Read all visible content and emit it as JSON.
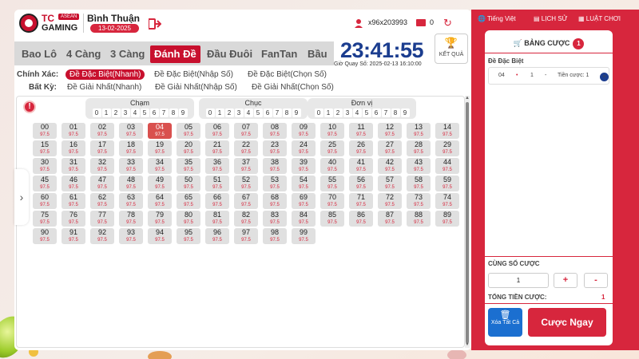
{
  "header": {
    "logo_tc": "TC",
    "logo_asean": "ASEAN",
    "logo_gaming": "GAMING",
    "province": "Bình Thuận",
    "date": "13-02-2025",
    "user_id": "x96x203993",
    "wallet": "0"
  },
  "tabs": [
    "Bao Lô",
    "4 Càng",
    "3 Càng",
    "Đánh Đề",
    "Đầu Đuôi",
    "FanTan",
    "Bầu"
  ],
  "active_tab": "Đánh Đề",
  "timer": "23:41:55",
  "draw_label": "Giờ Quay Số: 2025-02-13 16:10:00",
  "result_label": "KẾT QUẢ",
  "options": {
    "exact_label": "Chính Xác:",
    "any_label": "Bất Kỳ:",
    "exact": [
      "Đề Đặc Biệt(Nhanh)",
      "Đề Đặc Biệt(Nhập Số)",
      "Đề Đặc Biệt(Chọn Số)"
    ],
    "any": [
      "Đề Giải Nhất(Nhanh)",
      "Đề Giải Nhất(Nhập Số)",
      "Đề Giải Nhất(Chọn Số)"
    ]
  },
  "positions": [
    {
      "title": "Chạm"
    },
    {
      "title": "Chục"
    },
    {
      "title": "Đơn vị"
    }
  ],
  "digits": [
    "0",
    "1",
    "2",
    "3",
    "4",
    "5",
    "6",
    "7",
    "8",
    "9"
  ],
  "odds": "97.5",
  "selected_number": "04",
  "sidebar": {
    "lang": "Tiếng Việt",
    "history": "LỊCH SỬ",
    "rules": "LUẬT CHƠI",
    "cart_title": "BẢNG CƯỢC",
    "cart_count": "1",
    "bet_type": "Đề Đặc Biệt",
    "bet_number": "04",
    "bet_dot": "•",
    "bet_qty": "1",
    "bet_dash": "-",
    "bet_amount_label": "Tiền cược: 1",
    "same_label": "CÙNG SỐ CƯỢC",
    "qty_value": "1",
    "plus": "+",
    "minus": "-",
    "total_label": "TỔNG TIỀN CƯỢC:",
    "total_value": "1",
    "clear_label": "Xóa Tất Cả",
    "bet_button": "Cược Ngay"
  },
  "colors": {
    "accent": "#d7263d",
    "timer": "#1b3d8f",
    "clear": "#1b6fd0"
  }
}
